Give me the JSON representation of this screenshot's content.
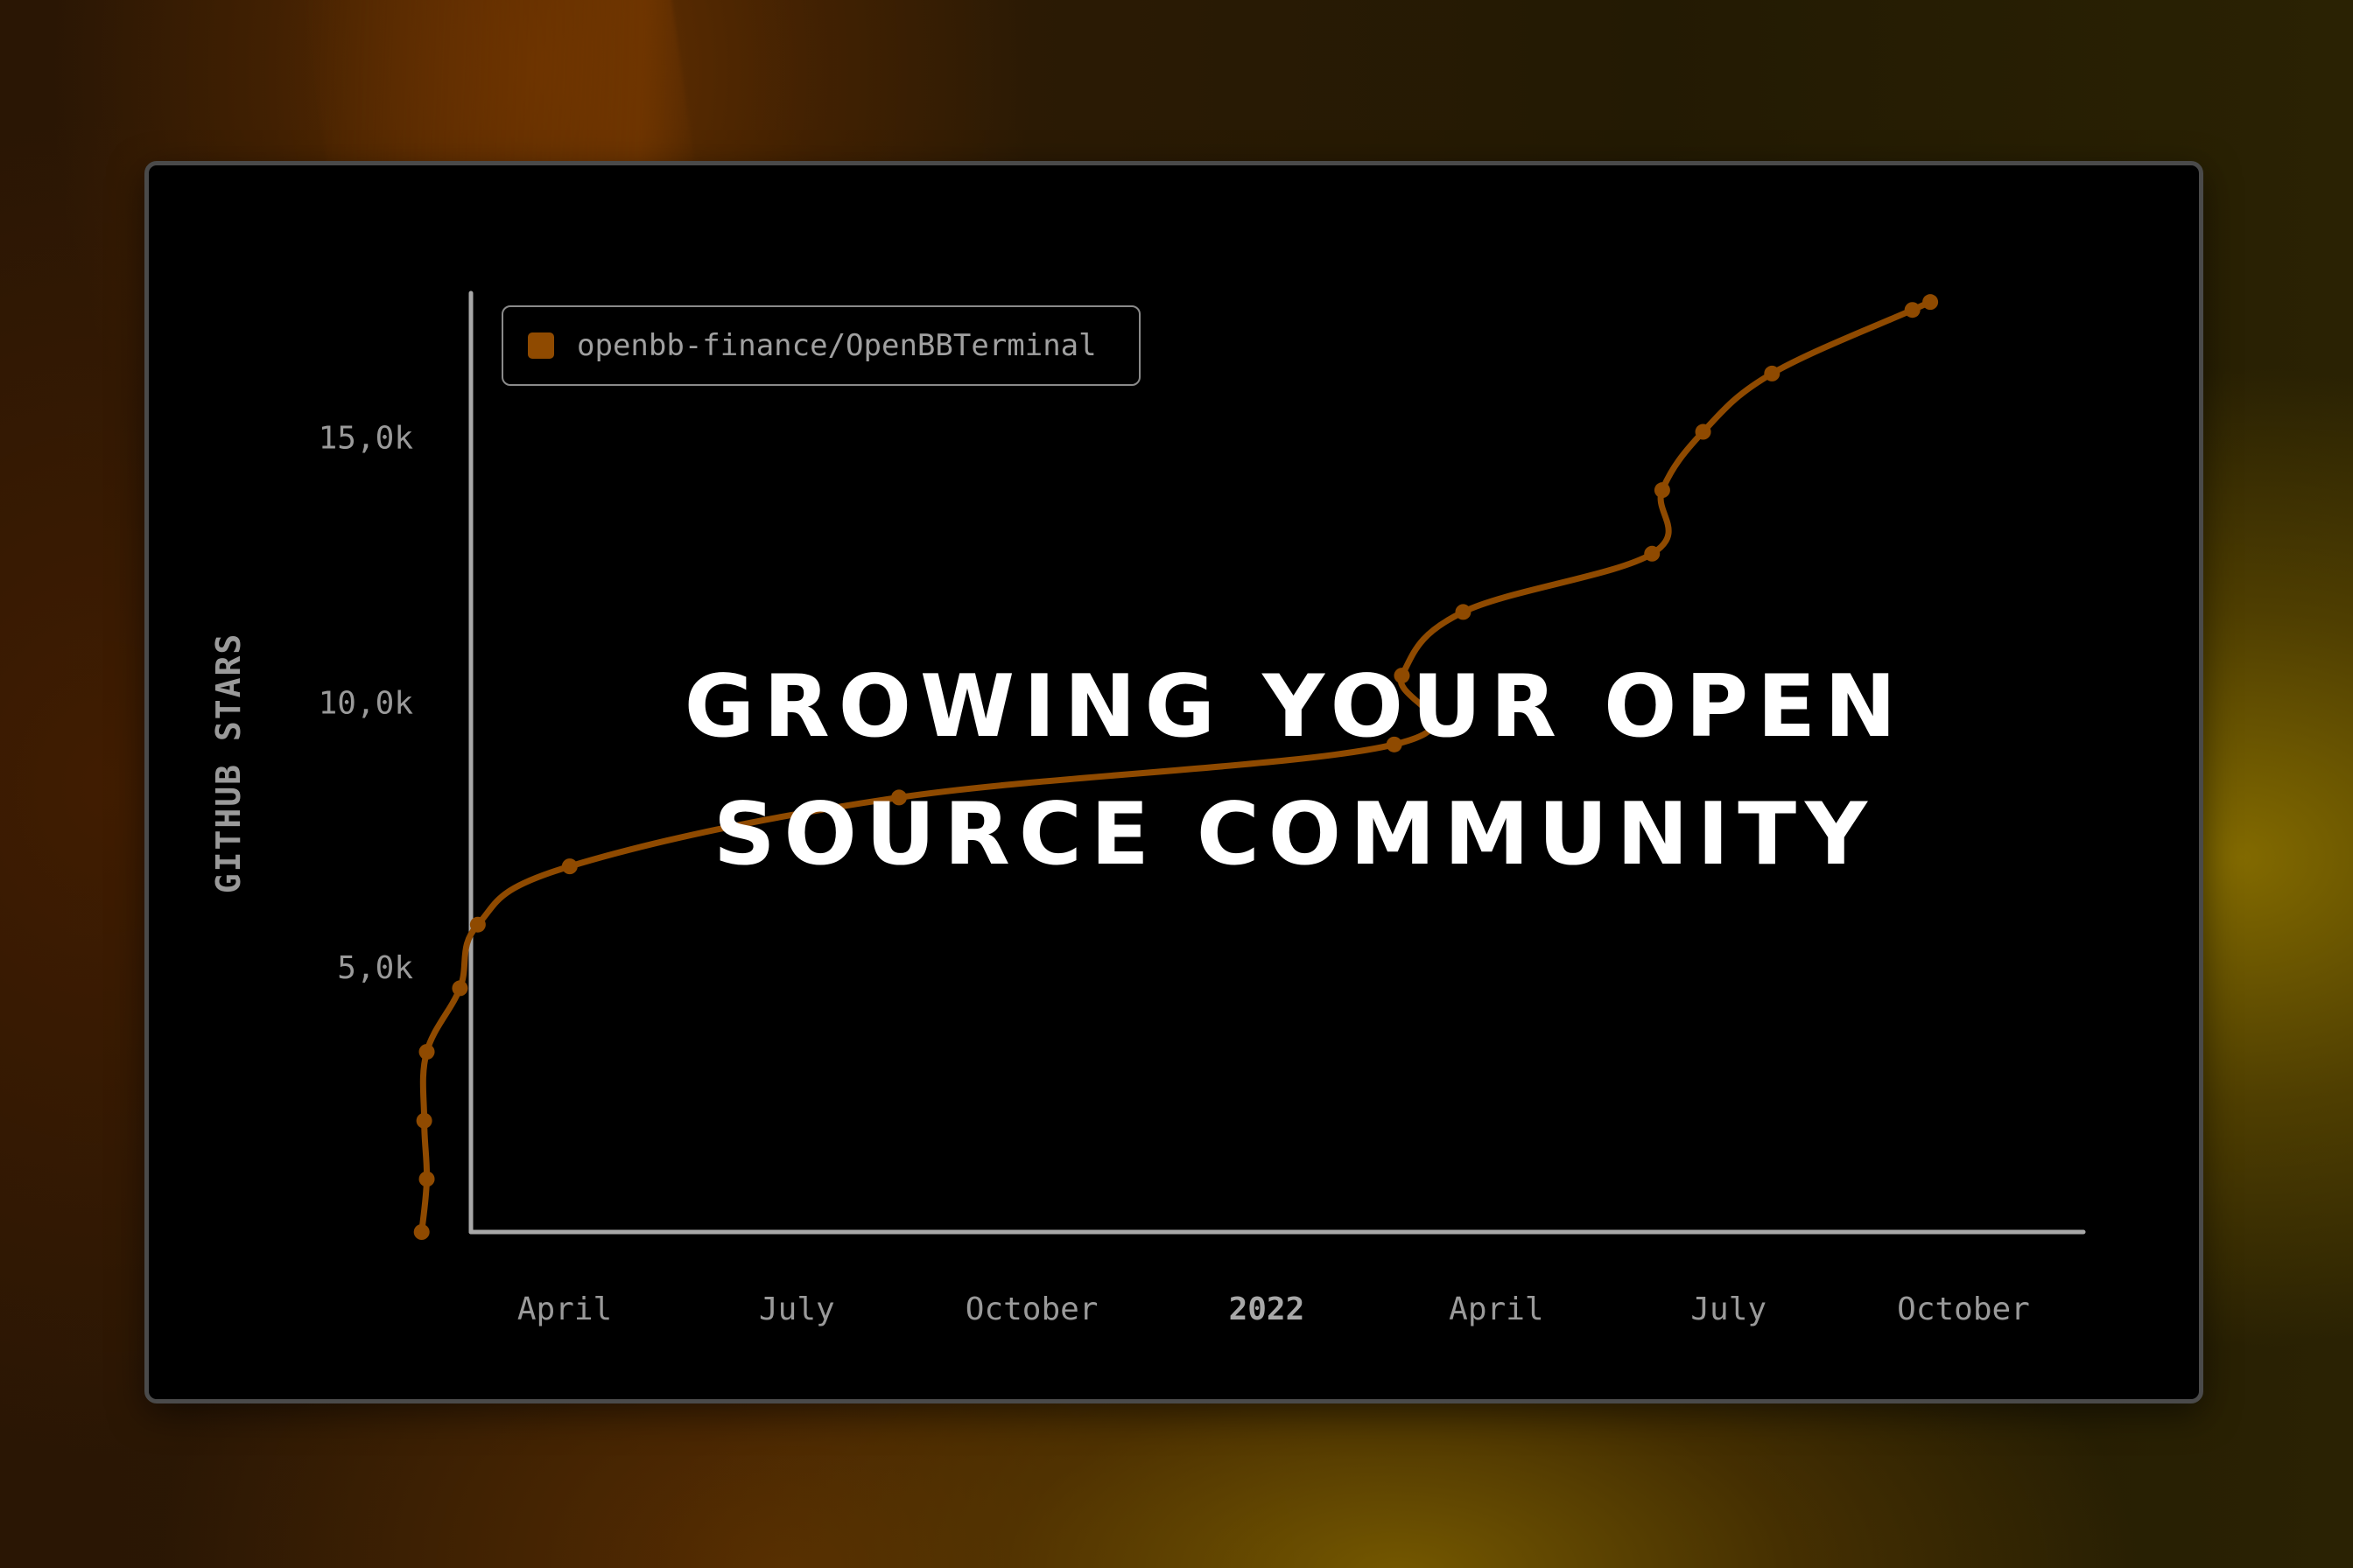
{
  "colors": {
    "series": "#8f4a00",
    "axis": "#a8a8a8",
    "tick_text": "#9a9a9a",
    "card_bg": "#000000",
    "card_border": "#4a4a4a",
    "headline": "#ffffff"
  },
  "headline": {
    "line1": "GROWING YOUR OPEN",
    "line2": "SOURCE COMMUNITY"
  },
  "chart_data": {
    "type": "line",
    "title": "",
    "xlabel": "",
    "ylabel": "GITHUB STARS",
    "legend": {
      "placement": "top-left",
      "entries": [
        "openbb-finance/OpenBBTerminal"
      ]
    },
    "grid": false,
    "x_ticks": [
      {
        "label": "April",
        "date": "2021-04-01",
        "bold": false
      },
      {
        "label": "July",
        "date": "2021-07-01",
        "bold": false
      },
      {
        "label": "October",
        "date": "2021-10-01",
        "bold": false
      },
      {
        "label": "2022",
        "date": "2022-01-01",
        "bold": true
      },
      {
        "label": "April",
        "date": "2022-04-01",
        "bold": false
      },
      {
        "label": "July",
        "date": "2022-07-01",
        "bold": false
      },
      {
        "label": "October",
        "date": "2022-10-01",
        "bold": false
      }
    ],
    "y_ticks": [
      {
        "label": "5,0k",
        "value": 5000
      },
      {
        "label": "10,0k",
        "value": 10000
      },
      {
        "label": "15,0k",
        "value": 15000
      }
    ],
    "xlim": [
      "2021-02-04",
      "2022-12-15"
    ],
    "ylim": [
      0,
      17800
    ],
    "series": [
      {
        "name": "openbb-finance/OpenBBTerminal",
        "points": [
          {
            "date": "2021-02-04",
            "value": 0
          },
          {
            "date": "2021-02-06",
            "value": 1000
          },
          {
            "date": "2021-02-05",
            "value": 2100
          },
          {
            "date": "2021-02-06",
            "value": 3400
          },
          {
            "date": "2021-02-19",
            "value": 4600
          },
          {
            "date": "2021-02-26",
            "value": 5800
          },
          {
            "date": "2021-04-03",
            "value": 6900
          },
          {
            "date": "2021-08-10",
            "value": 8200
          },
          {
            "date": "2022-02-20",
            "value": 9200
          },
          {
            "date": "2022-02-23",
            "value": 10500
          },
          {
            "date": "2022-03-19",
            "value": 11700
          },
          {
            "date": "2022-06-01",
            "value": 12800
          },
          {
            "date": "2022-06-05",
            "value": 14000
          },
          {
            "date": "2022-06-21",
            "value": 15100
          },
          {
            "date": "2022-07-18",
            "value": 16200
          },
          {
            "date": "2022-09-11",
            "value": 17400
          },
          {
            "date": "2022-09-18",
            "value": 17550
          }
        ]
      }
    ]
  }
}
